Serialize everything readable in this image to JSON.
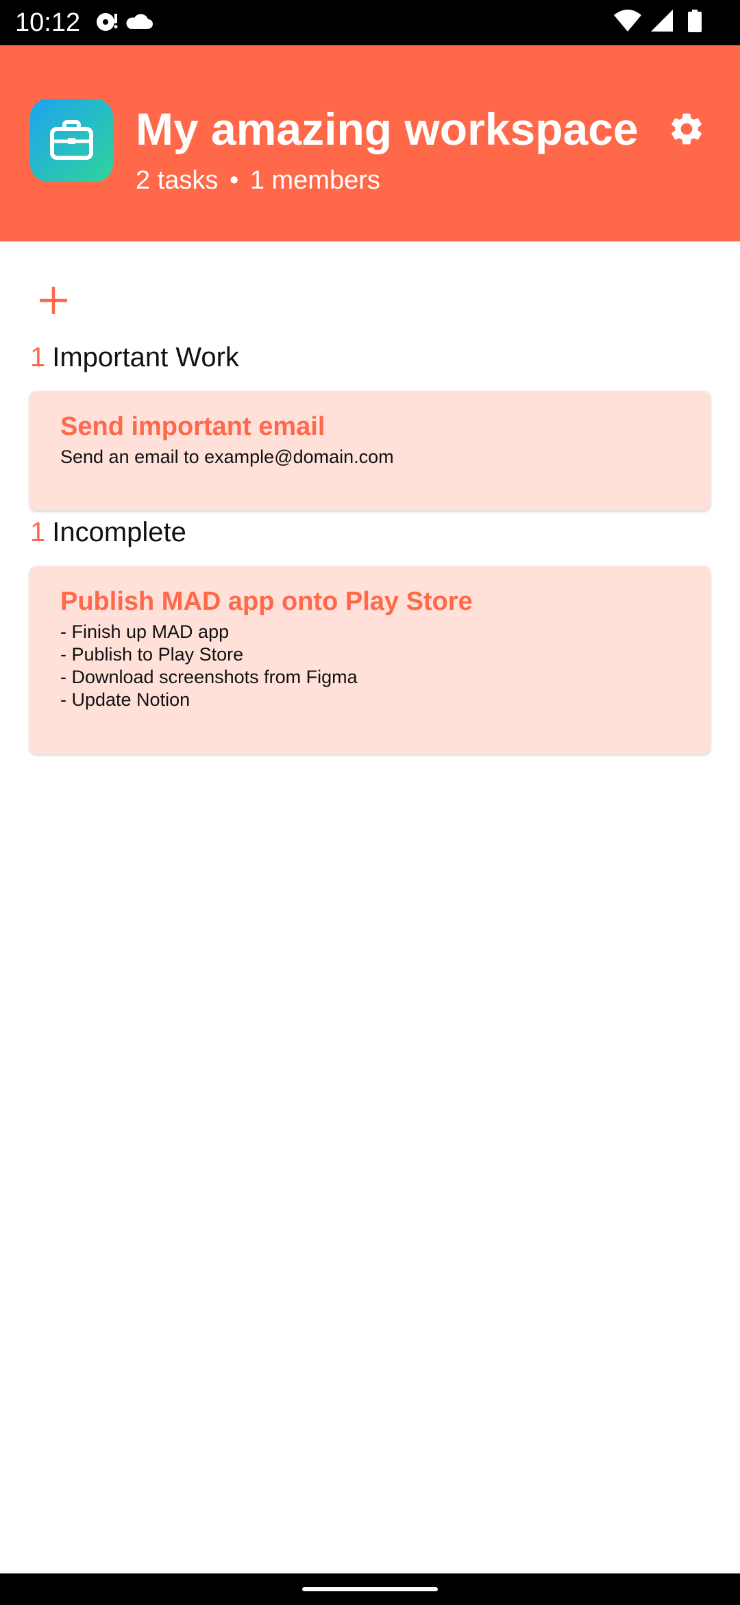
{
  "status_bar": {
    "time": "10:12",
    "left_icons": [
      "media-icon",
      "cloud-icon"
    ],
    "right_icons": [
      "wifi-icon",
      "signal-icon",
      "battery-icon"
    ]
  },
  "workspace": {
    "title": "My amazing workspace",
    "task_count": "2 tasks",
    "separator": "•",
    "member_count": "1 members",
    "icon": "briefcase-icon",
    "settings_icon": "gear-icon"
  },
  "add_button_icon": "plus-icon",
  "sections": [
    {
      "count": "1",
      "name": "Important Work",
      "tasks": [
        {
          "title": "Send important email",
          "description_lines": [
            "Send an email to example@domain.com"
          ]
        }
      ]
    },
    {
      "count": "1",
      "name": "Incomplete",
      "tasks": [
        {
          "title": "Publish MAD app onto Play Store",
          "description_lines": [
            "- Finish up MAD app",
            "- Publish to Play Store",
            "- Download screenshots from Figma",
            "- Update Notion"
          ]
        }
      ]
    }
  ],
  "colors": {
    "accent": "#FF6849",
    "card_background": "#FFE1DA",
    "icon_gradient_start": "#1EA3F0",
    "icon_gradient_end": "#2ED59A"
  }
}
